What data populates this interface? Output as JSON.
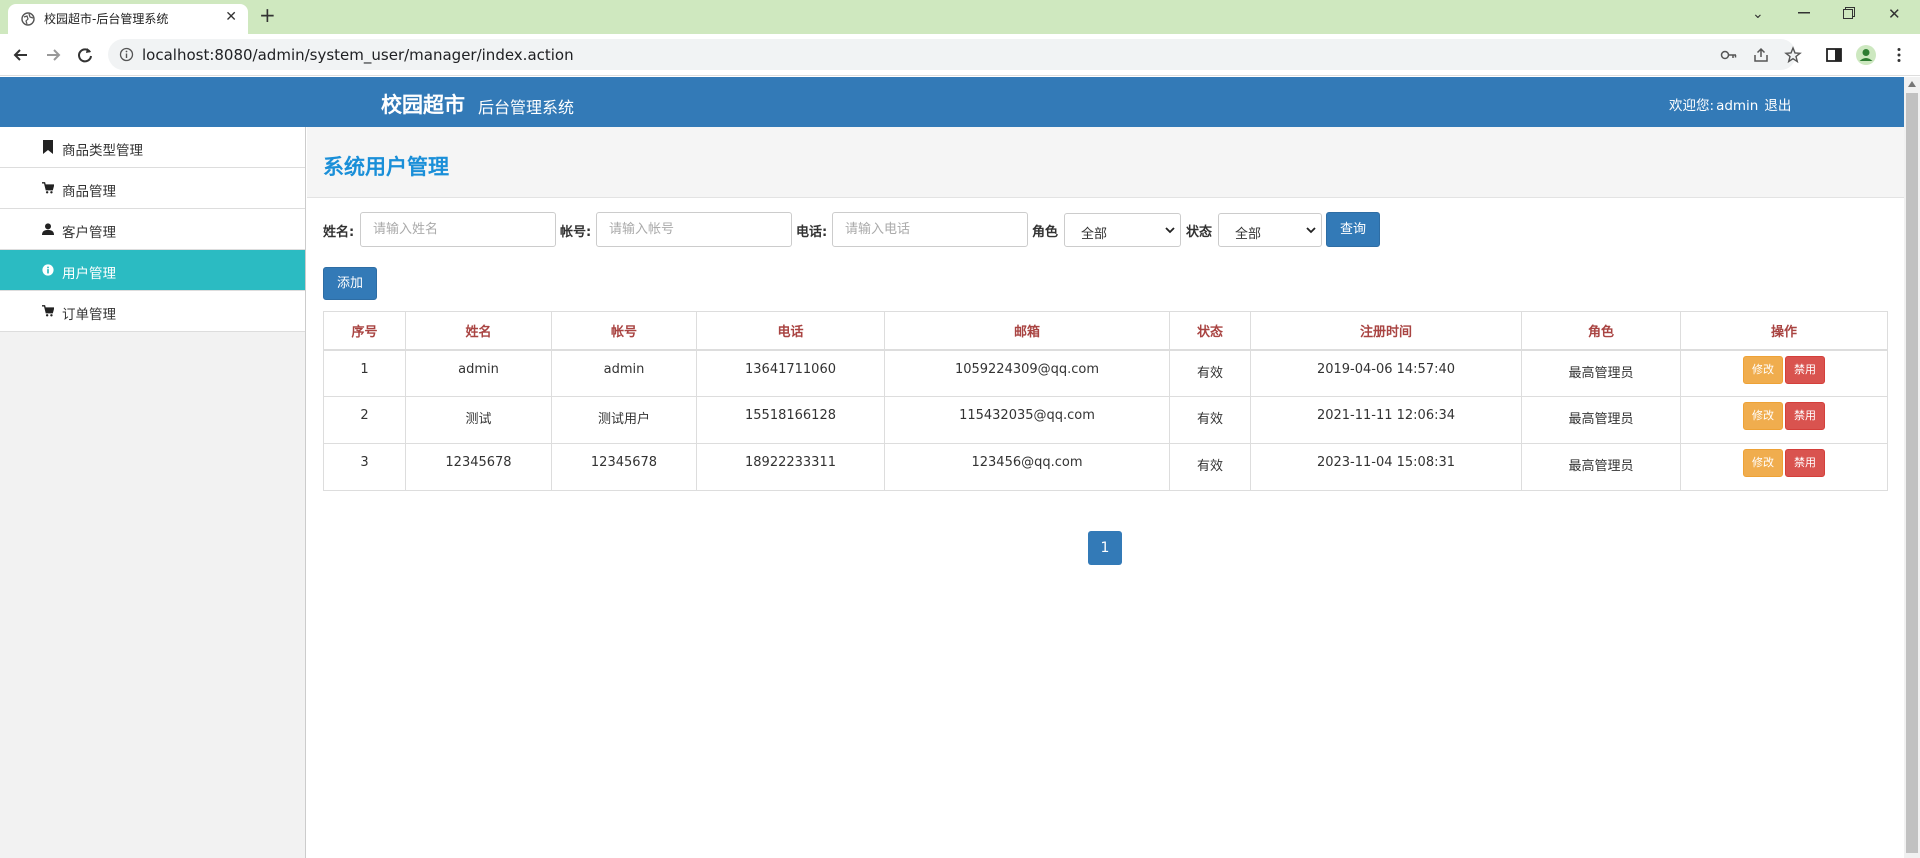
{
  "browser": {
    "tab_title": "校园超市-后台管理系统",
    "url": "localhost:8080/admin/system_user/manager/index.action"
  },
  "header": {
    "brand": "校园超市",
    "subtitle": "后台管理系统",
    "welcome": "欢迎您:",
    "username": "admin",
    "logout": "退出"
  },
  "sidebar": {
    "items": [
      {
        "label": "商品类型管理",
        "icon": "bookmark-icon"
      },
      {
        "label": "商品管理",
        "icon": "cart-icon"
      },
      {
        "label": "客户管理",
        "icon": "user-icon"
      },
      {
        "label": "用户管理",
        "icon": "info-icon",
        "active": true
      },
      {
        "label": "订单管理",
        "icon": "cart-icon"
      }
    ]
  },
  "page": {
    "title": "系统用户管理"
  },
  "filters": {
    "name_label": "姓名:",
    "name_placeholder": "请输入姓名",
    "account_label": "帐号:",
    "account_placeholder": "请输入帐号",
    "phone_label": "电话:",
    "phone_placeholder": "请输入电话",
    "role_label": "角色",
    "role_value": "全部",
    "status_label": "状态",
    "status_value": "全部",
    "query_button": "查询"
  },
  "actions": {
    "add_button": "添加"
  },
  "table": {
    "headers": [
      "序号",
      "姓名",
      "帐号",
      "电话",
      "邮箱",
      "状态",
      "注册时间",
      "角色",
      "操作"
    ],
    "rows": [
      {
        "no": "1",
        "name": "admin",
        "account": "admin",
        "phone": "13641711060",
        "email": "1059224309@qq.com",
        "status": "有效",
        "registered": "2019-04-06 14:57:40",
        "role": "最高管理员",
        "edit": "修改",
        "disable": "禁用"
      },
      {
        "no": "2",
        "name": "测试",
        "account": "测试用户",
        "phone": "15518166128",
        "email": "115432035@qq.com",
        "status": "有效",
        "registered": "2021-11-11 12:06:34",
        "role": "最高管理员",
        "edit": "修改",
        "disable": "禁用"
      },
      {
        "no": "3",
        "name": "12345678",
        "account": "12345678",
        "phone": "18922233311",
        "email": "123456@qq.com",
        "status": "有效",
        "registered": "2023-11-04 15:08:31",
        "role": "最高管理员",
        "edit": "修改",
        "disable": "禁用"
      }
    ]
  },
  "pagination": {
    "current_page": "1"
  },
  "colors": {
    "header_bg": "#337ab7",
    "sidebar_active": "#2bbbc2",
    "title": "#1a8fd8",
    "table_header_text": "#a94442",
    "edit_button": "#f0ad4e",
    "disable_button": "#d9534f"
  }
}
